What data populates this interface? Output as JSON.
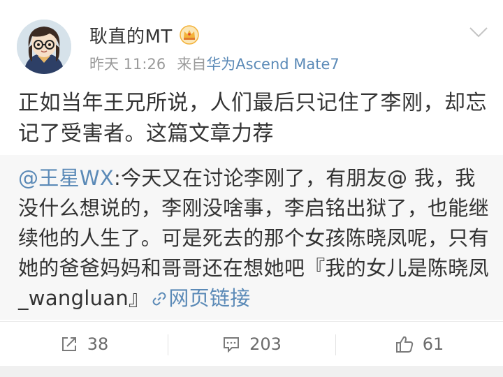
{
  "post": {
    "username": "耿直的MT",
    "time": "昨天 11:26",
    "source_prefix": "来自",
    "source_device": "华为Ascend Mate7",
    "text": "正如当年王兄所说，人们最后只记住了李刚，却忘记了受害者。这篇文章力荐"
  },
  "repost": {
    "mention": "@王星WX",
    "text": ":今天又在讨论李刚了，有朋友@ 我，我没什么想说的，李刚没啥事，李启铭出狱了，也能继续他的人生了。可是死去的那个女孩陈晓凤呢，只有她的爸爸妈妈和哥哥还在想她吧『我的女儿是陈晓凤_wangluan』",
    "link_label": "网页链接"
  },
  "actions": {
    "repost_count": "38",
    "comment_count": "203",
    "like_count": "61"
  },
  "icons": {
    "badge": "crown-vip-icon",
    "menu": "chevron-down-icon",
    "link": "link-icon",
    "repost": "share-arrow-icon",
    "comment": "comment-icon",
    "like": "thumbs-up-icon"
  },
  "colors": {
    "link_blue": "#5b8ab7",
    "badge_gold": "#f3b23a",
    "repost_bg": "#f7f7f7",
    "meta_gray": "#9a9a9a"
  }
}
